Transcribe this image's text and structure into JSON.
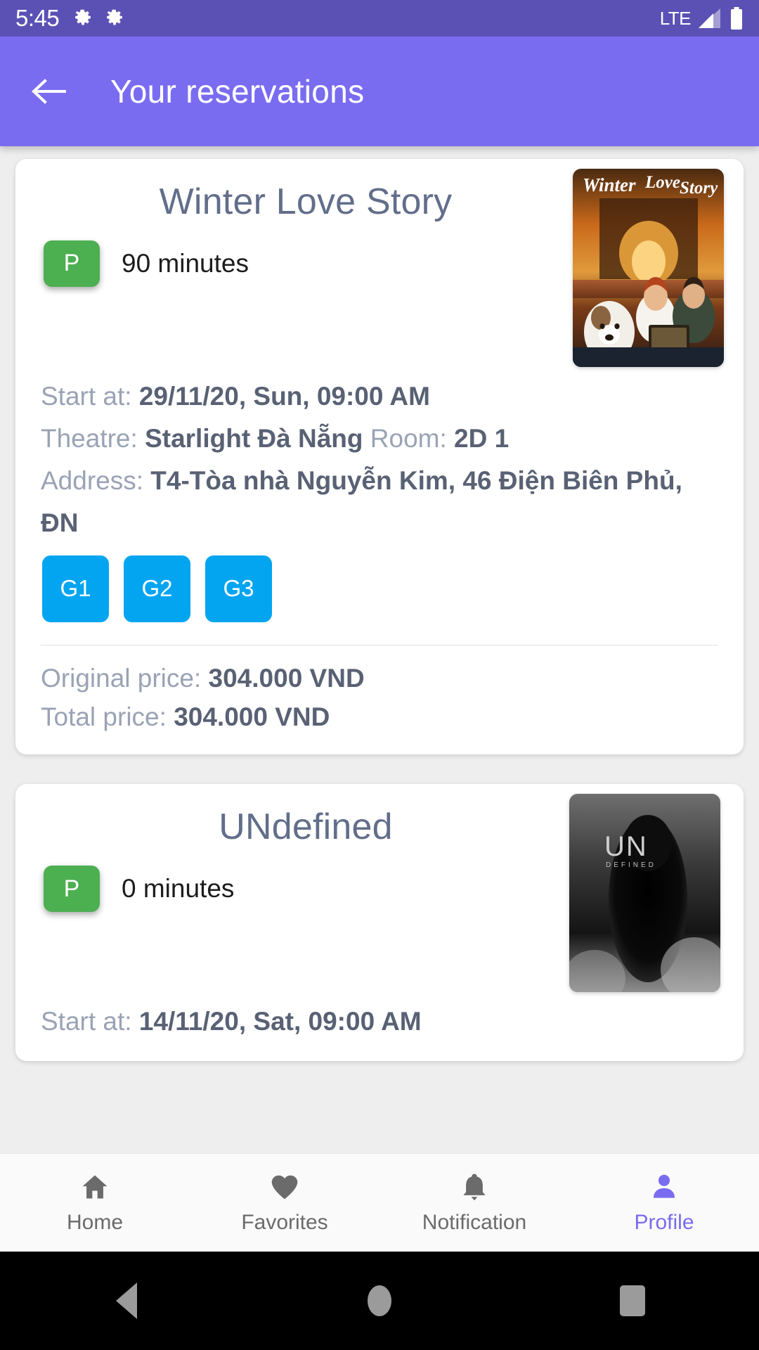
{
  "status_bar": {
    "time": "5:45",
    "icons_left": [
      "gear-icon",
      "gear-icon"
    ],
    "network": "LTE",
    "signal_icon": "signal-bars-icon",
    "battery_icon": "battery-full-icon"
  },
  "app_bar": {
    "back_icon": "back-arrow-icon",
    "title": "Your reservations"
  },
  "reservations": [
    {
      "title": "Winter Love Story",
      "rating": "P",
      "duration": "90 minutes",
      "poster_alt": "Winter Love Story",
      "start_label": "Start at: ",
      "start_value": "29/11/20, Sun, 09:00 AM",
      "theatre_label": "Theatre: ",
      "theatre_value": "Starlight Đà Nẵng",
      "room_label": " Room: ",
      "room_value": "2D 1",
      "address_label": "Address: ",
      "address_value": "T4-Tòa nhà Nguyễn Kim, 46 Điện Biên Phủ, ĐN",
      "seats": [
        "G1",
        "G2",
        "G3"
      ],
      "original_price_label": "Original price: ",
      "original_price_value": "304.000  VND",
      "total_price_label": "Total price: ",
      "total_price_value": "304.000  VND"
    },
    {
      "title": "UNdefined",
      "rating": "P",
      "duration": "0 minutes",
      "poster_alt": "UNdefined",
      "poster_text_main": "UN",
      "poster_text_sub": "DEFINED",
      "start_label": "Start at: ",
      "start_value": "14/11/20, Sat, 09:00 AM"
    }
  ],
  "bottom_nav": {
    "items": [
      {
        "label": "Home",
        "icon": "home-icon",
        "active": false
      },
      {
        "label": "Favorites",
        "icon": "heart-icon",
        "active": false
      },
      {
        "label": "Notification",
        "icon": "bell-icon",
        "active": false
      },
      {
        "label": "Profile",
        "icon": "person-icon",
        "active": true
      }
    ]
  },
  "android_nav": {
    "back": "triangle-back-icon",
    "home": "circle-home-icon",
    "recents": "square-recents-icon"
  },
  "colors": {
    "status_bar": "#5b51b5",
    "app_bar": "#7a6cf0",
    "accent": "#7a6cf0",
    "rating_badge": "#4caf50",
    "seat_chip": "#03a5f0",
    "title_text": "#626e8a",
    "label_text": "#9aa3b5",
    "value_text": "#596174",
    "page_bg": "#eeeeee"
  }
}
